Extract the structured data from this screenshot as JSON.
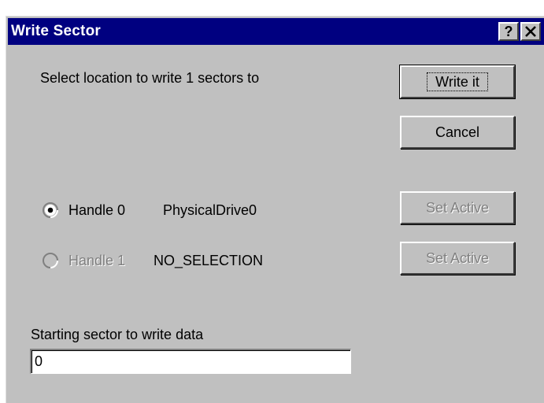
{
  "window": {
    "title": "Write Sector",
    "help_label": "?",
    "close_label": "✕"
  },
  "instruction": "Select location to write 1 sectors to",
  "buttons": {
    "write_it": "Write it",
    "cancel": "Cancel",
    "set_active_0": "Set Active",
    "set_active_1": "Set Active"
  },
  "handles": [
    {
      "label": "Handle 0",
      "device": "PhysicalDrive0",
      "selected": true,
      "enabled": true
    },
    {
      "label": "Handle 1",
      "device": "NO_SELECTION",
      "selected": false,
      "enabled": false
    }
  ],
  "starting_sector": {
    "label": "Starting sector to write data",
    "value": "0"
  }
}
